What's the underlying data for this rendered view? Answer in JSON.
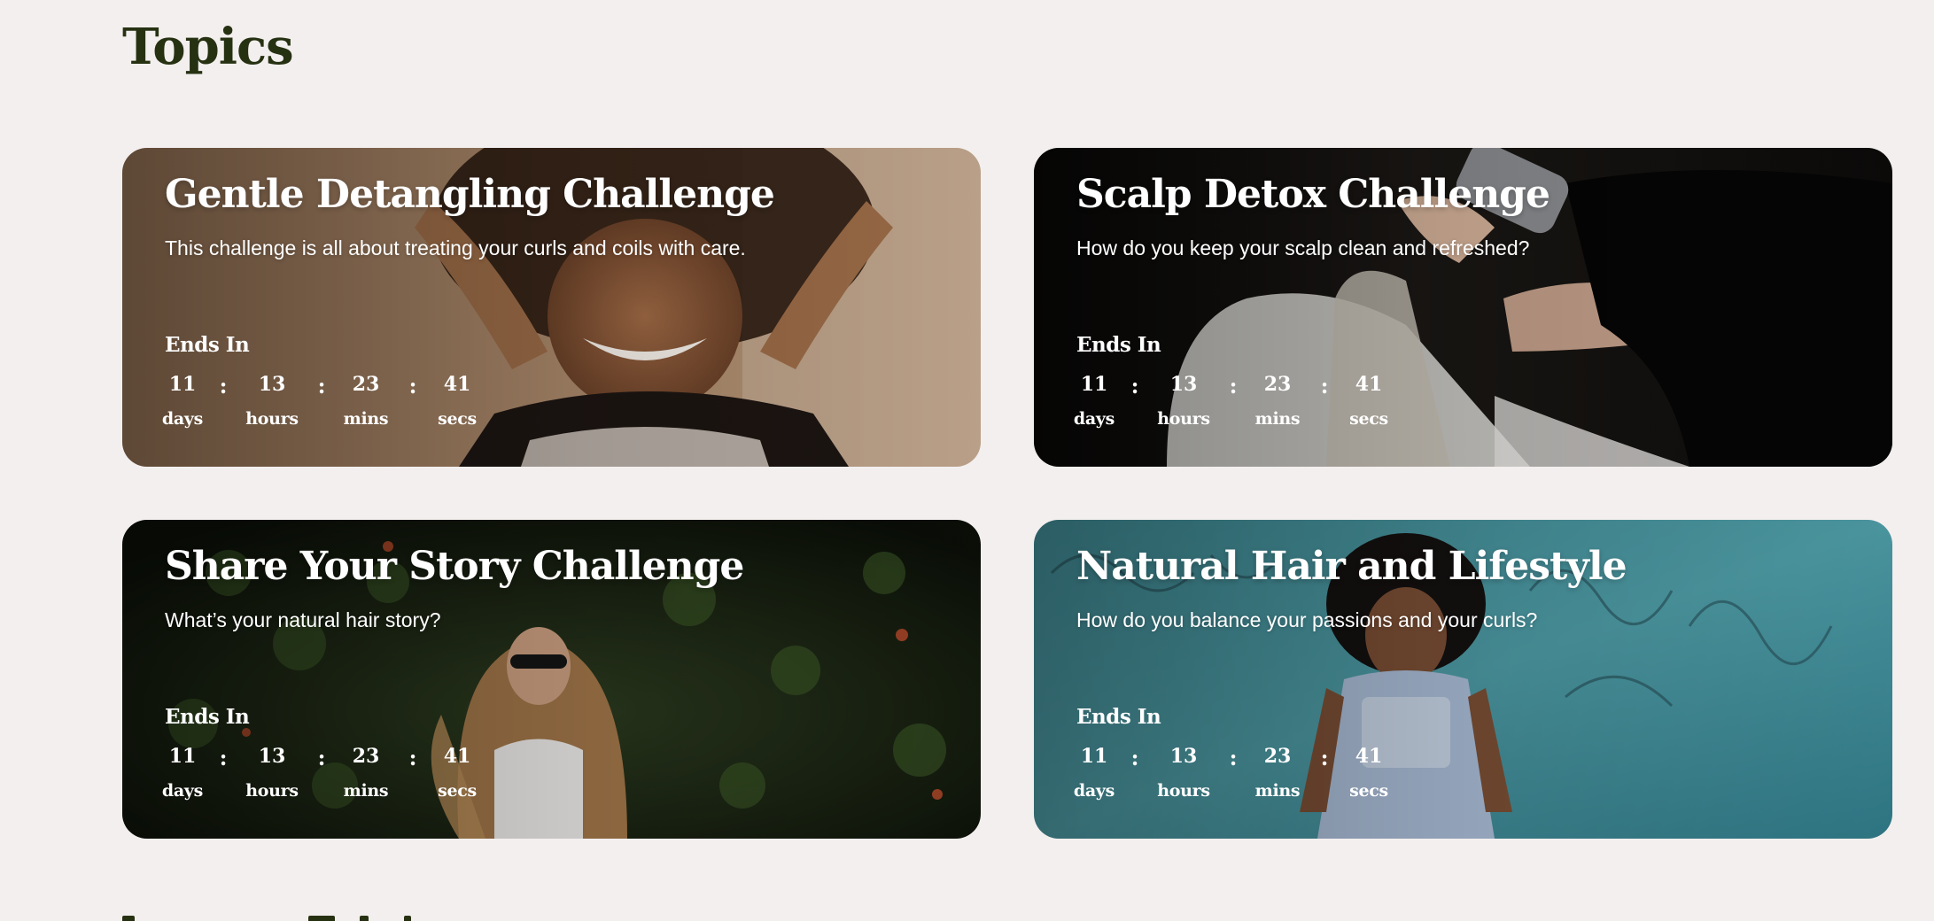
{
  "page": {
    "title": "Topics"
  },
  "challenges": [
    {
      "title": "Gentle Detangling Challenge",
      "description": "This challenge is all about treating your curls and coils with care.",
      "ends_label": "Ends In",
      "countdown": {
        "days": "11",
        "hours": "13",
        "mins": "23",
        "secs": "41",
        "days_label": "days",
        "hours_label": "hours",
        "mins_label": "mins",
        "secs_label": "secs",
        "separator": ":"
      },
      "image_icon": "woman-curly-hair-photo",
      "accent_color": "#b58a66"
    },
    {
      "title": "Scalp Detox Challenge",
      "description": "How do you keep your scalp clean and refreshed?",
      "ends_label": "Ends In",
      "countdown": {
        "days": "11",
        "hours": "13",
        "mins": "23",
        "secs": "41",
        "days_label": "days",
        "hours_label": "hours",
        "mins_label": "mins",
        "secs_label": "secs",
        "separator": ":"
      },
      "image_icon": "hair-washing-photo",
      "accent_color": "#1a1816"
    },
    {
      "title": "Share Your Story Challenge",
      "description": "What’s your natural hair story?",
      "ends_label": "Ends In",
      "countdown": {
        "days": "11",
        "hours": "13",
        "mins": "23",
        "secs": "41",
        "days_label": "days",
        "hours_label": "hours",
        "mins_label": "mins",
        "secs_label": "secs",
        "separator": ":"
      },
      "image_icon": "woman-sunglasses-ivy-photo",
      "accent_color": "#1d2a14"
    },
    {
      "title": "Natural Hair and Lifestyle",
      "description": "How do you balance your passions and your curls?",
      "ends_label": "Ends In",
      "countdown": {
        "days": "11",
        "hours": "13",
        "mins": "23",
        "secs": "41",
        "days_label": "days",
        "hours_label": "hours",
        "mins_label": "mins",
        "secs_label": "secs",
        "separator": ":"
      },
      "image_icon": "woman-teal-wall-photo",
      "accent_color": "#3d8a95"
    }
  ],
  "colors": {
    "page_background": "#f3efee",
    "heading": "#263112",
    "card_text": "#ffffff"
  }
}
